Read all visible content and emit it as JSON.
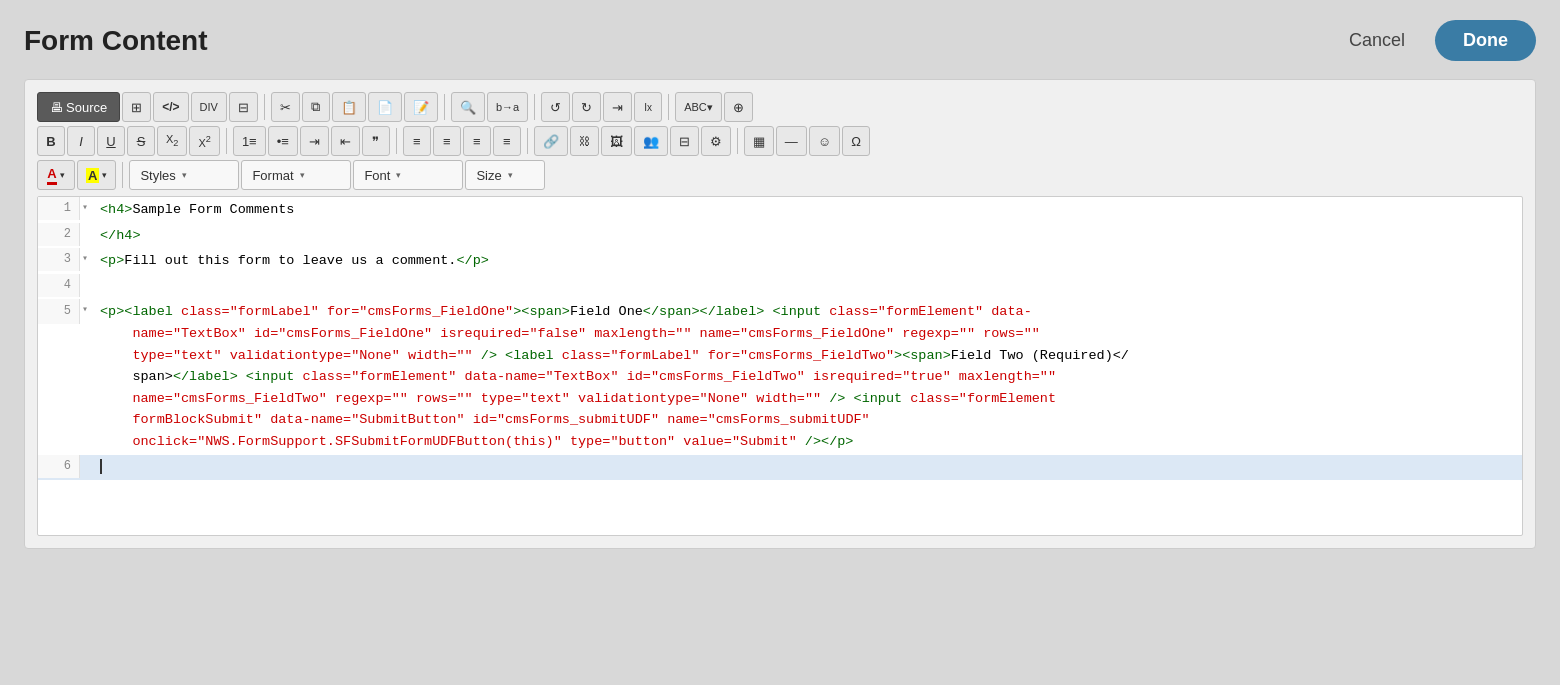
{
  "header": {
    "title": "Form Content",
    "cancel_label": "Cancel",
    "done_label": "Done"
  },
  "toolbar": {
    "row1": {
      "source_label": "Source",
      "buttons": [
        {
          "id": "source",
          "label": "Source",
          "icon": "🖶",
          "active": true
        },
        {
          "id": "show-blocks",
          "label": "Show Blocks",
          "icon": "⊞",
          "active": false
        },
        {
          "id": "source-code",
          "label": "Source Code",
          "icon": "</>",
          "active": false
        },
        {
          "id": "div-container",
          "label": "Div Container",
          "icon": "÷",
          "active": false
        },
        {
          "id": "clipboard-plain",
          "label": "Paste as Plain Text",
          "icon": "📋",
          "active": false
        },
        {
          "id": "cut",
          "label": "Cut",
          "icon": "✂",
          "active": false
        },
        {
          "id": "copy",
          "label": "Copy",
          "icon": "⧉",
          "active": false
        },
        {
          "id": "paste",
          "label": "Paste",
          "icon": "📄",
          "active": false
        },
        {
          "id": "paste-word",
          "label": "Paste from Word",
          "icon": "📝",
          "active": false
        },
        {
          "id": "paste-text",
          "label": "Paste as Text",
          "icon": "🗒",
          "active": false
        },
        {
          "id": "find",
          "label": "Find",
          "icon": "🔍",
          "active": false
        },
        {
          "id": "replace",
          "label": "Replace",
          "icon": "↔",
          "active": false
        },
        {
          "id": "undo",
          "label": "Undo",
          "icon": "↺",
          "active": false
        },
        {
          "id": "redo",
          "label": "Redo",
          "icon": "↻",
          "active": false
        },
        {
          "id": "indent",
          "label": "Indent",
          "icon": "⇥",
          "active": false
        },
        {
          "id": "outdent",
          "label": "Outdent",
          "icon": "⇤",
          "active": false
        },
        {
          "id": "remove-format",
          "label": "Remove Format",
          "icon": "✖",
          "active": false
        },
        {
          "id": "spellcheck",
          "label": "Spellcheck",
          "icon": "ABC",
          "active": false
        },
        {
          "id": "accessibility",
          "label": "Accessibility",
          "icon": "⊕",
          "active": false
        }
      ]
    },
    "row2": {
      "buttons": [
        {
          "id": "bold",
          "label": "Bold",
          "icon": "B",
          "style": "bold"
        },
        {
          "id": "italic",
          "label": "Italic",
          "icon": "I",
          "style": "italic"
        },
        {
          "id": "underline",
          "label": "Underline",
          "icon": "U",
          "style": "underline"
        },
        {
          "id": "strike",
          "label": "Strikethrough",
          "icon": "S",
          "style": "strike"
        },
        {
          "id": "subscript",
          "label": "Subscript",
          "icon": "X₂"
        },
        {
          "id": "superscript",
          "label": "Superscript",
          "icon": "X²"
        },
        {
          "id": "ordered-list",
          "label": "Ordered List",
          "icon": "≡"
        },
        {
          "id": "unordered-list",
          "label": "Unordered List",
          "icon": "≡"
        },
        {
          "id": "indent-list",
          "label": "Indent",
          "icon": "⇥"
        },
        {
          "id": "outdent-list",
          "label": "Outdent",
          "icon": "⇤"
        },
        {
          "id": "blockquote",
          "label": "Blockquote",
          "icon": "❝"
        },
        {
          "id": "align-left",
          "label": "Align Left",
          "icon": "≡"
        },
        {
          "id": "align-center",
          "label": "Align Center",
          "icon": "≡"
        },
        {
          "id": "align-right",
          "label": "Align Right",
          "icon": "≡"
        },
        {
          "id": "align-justify",
          "label": "Justify",
          "icon": "≡"
        },
        {
          "id": "link",
          "label": "Link",
          "icon": "🔗"
        },
        {
          "id": "unlink",
          "label": "Unlink",
          "icon": "⛓"
        },
        {
          "id": "image",
          "label": "Image",
          "icon": "🖼"
        },
        {
          "id": "table-insert",
          "label": "Insert Table",
          "icon": "⊞"
        },
        {
          "id": "iframe",
          "label": "iFrame",
          "icon": "⊟"
        },
        {
          "id": "settings",
          "label": "Settings",
          "icon": "⚙"
        },
        {
          "id": "table-menu",
          "label": "Table",
          "icon": "▦"
        },
        {
          "id": "hr",
          "label": "Horizontal Rule",
          "icon": "—"
        },
        {
          "id": "emoji",
          "label": "Emoji",
          "icon": "☺"
        },
        {
          "id": "special-char",
          "label": "Special Character",
          "icon": "Ω"
        }
      ]
    },
    "row3": {
      "color_text_label": "A",
      "color_bg_label": "A",
      "dropdowns": [
        {
          "id": "styles",
          "label": "Styles"
        },
        {
          "id": "format",
          "label": "Format"
        },
        {
          "id": "font",
          "label": "Font"
        },
        {
          "id": "size",
          "label": "Size"
        }
      ]
    }
  },
  "code_editor": {
    "lines": [
      {
        "number": "1",
        "has_arrow": true,
        "content": "<h4>Sample Form Comments",
        "highlighted": false
      },
      {
        "number": "2",
        "has_arrow": false,
        "content": "</h4>",
        "highlighted": false
      },
      {
        "number": "3",
        "has_arrow": true,
        "content": "<p>Fill out this form to leave us a comment.</p>",
        "highlighted": false
      },
      {
        "number": "4",
        "has_arrow": false,
        "content": "",
        "highlighted": false
      },
      {
        "number": "5",
        "has_arrow": true,
        "content_complex": true,
        "highlighted": false
      },
      {
        "number": "6",
        "has_arrow": false,
        "content": "",
        "highlighted": true,
        "has_cursor": true
      }
    ]
  }
}
